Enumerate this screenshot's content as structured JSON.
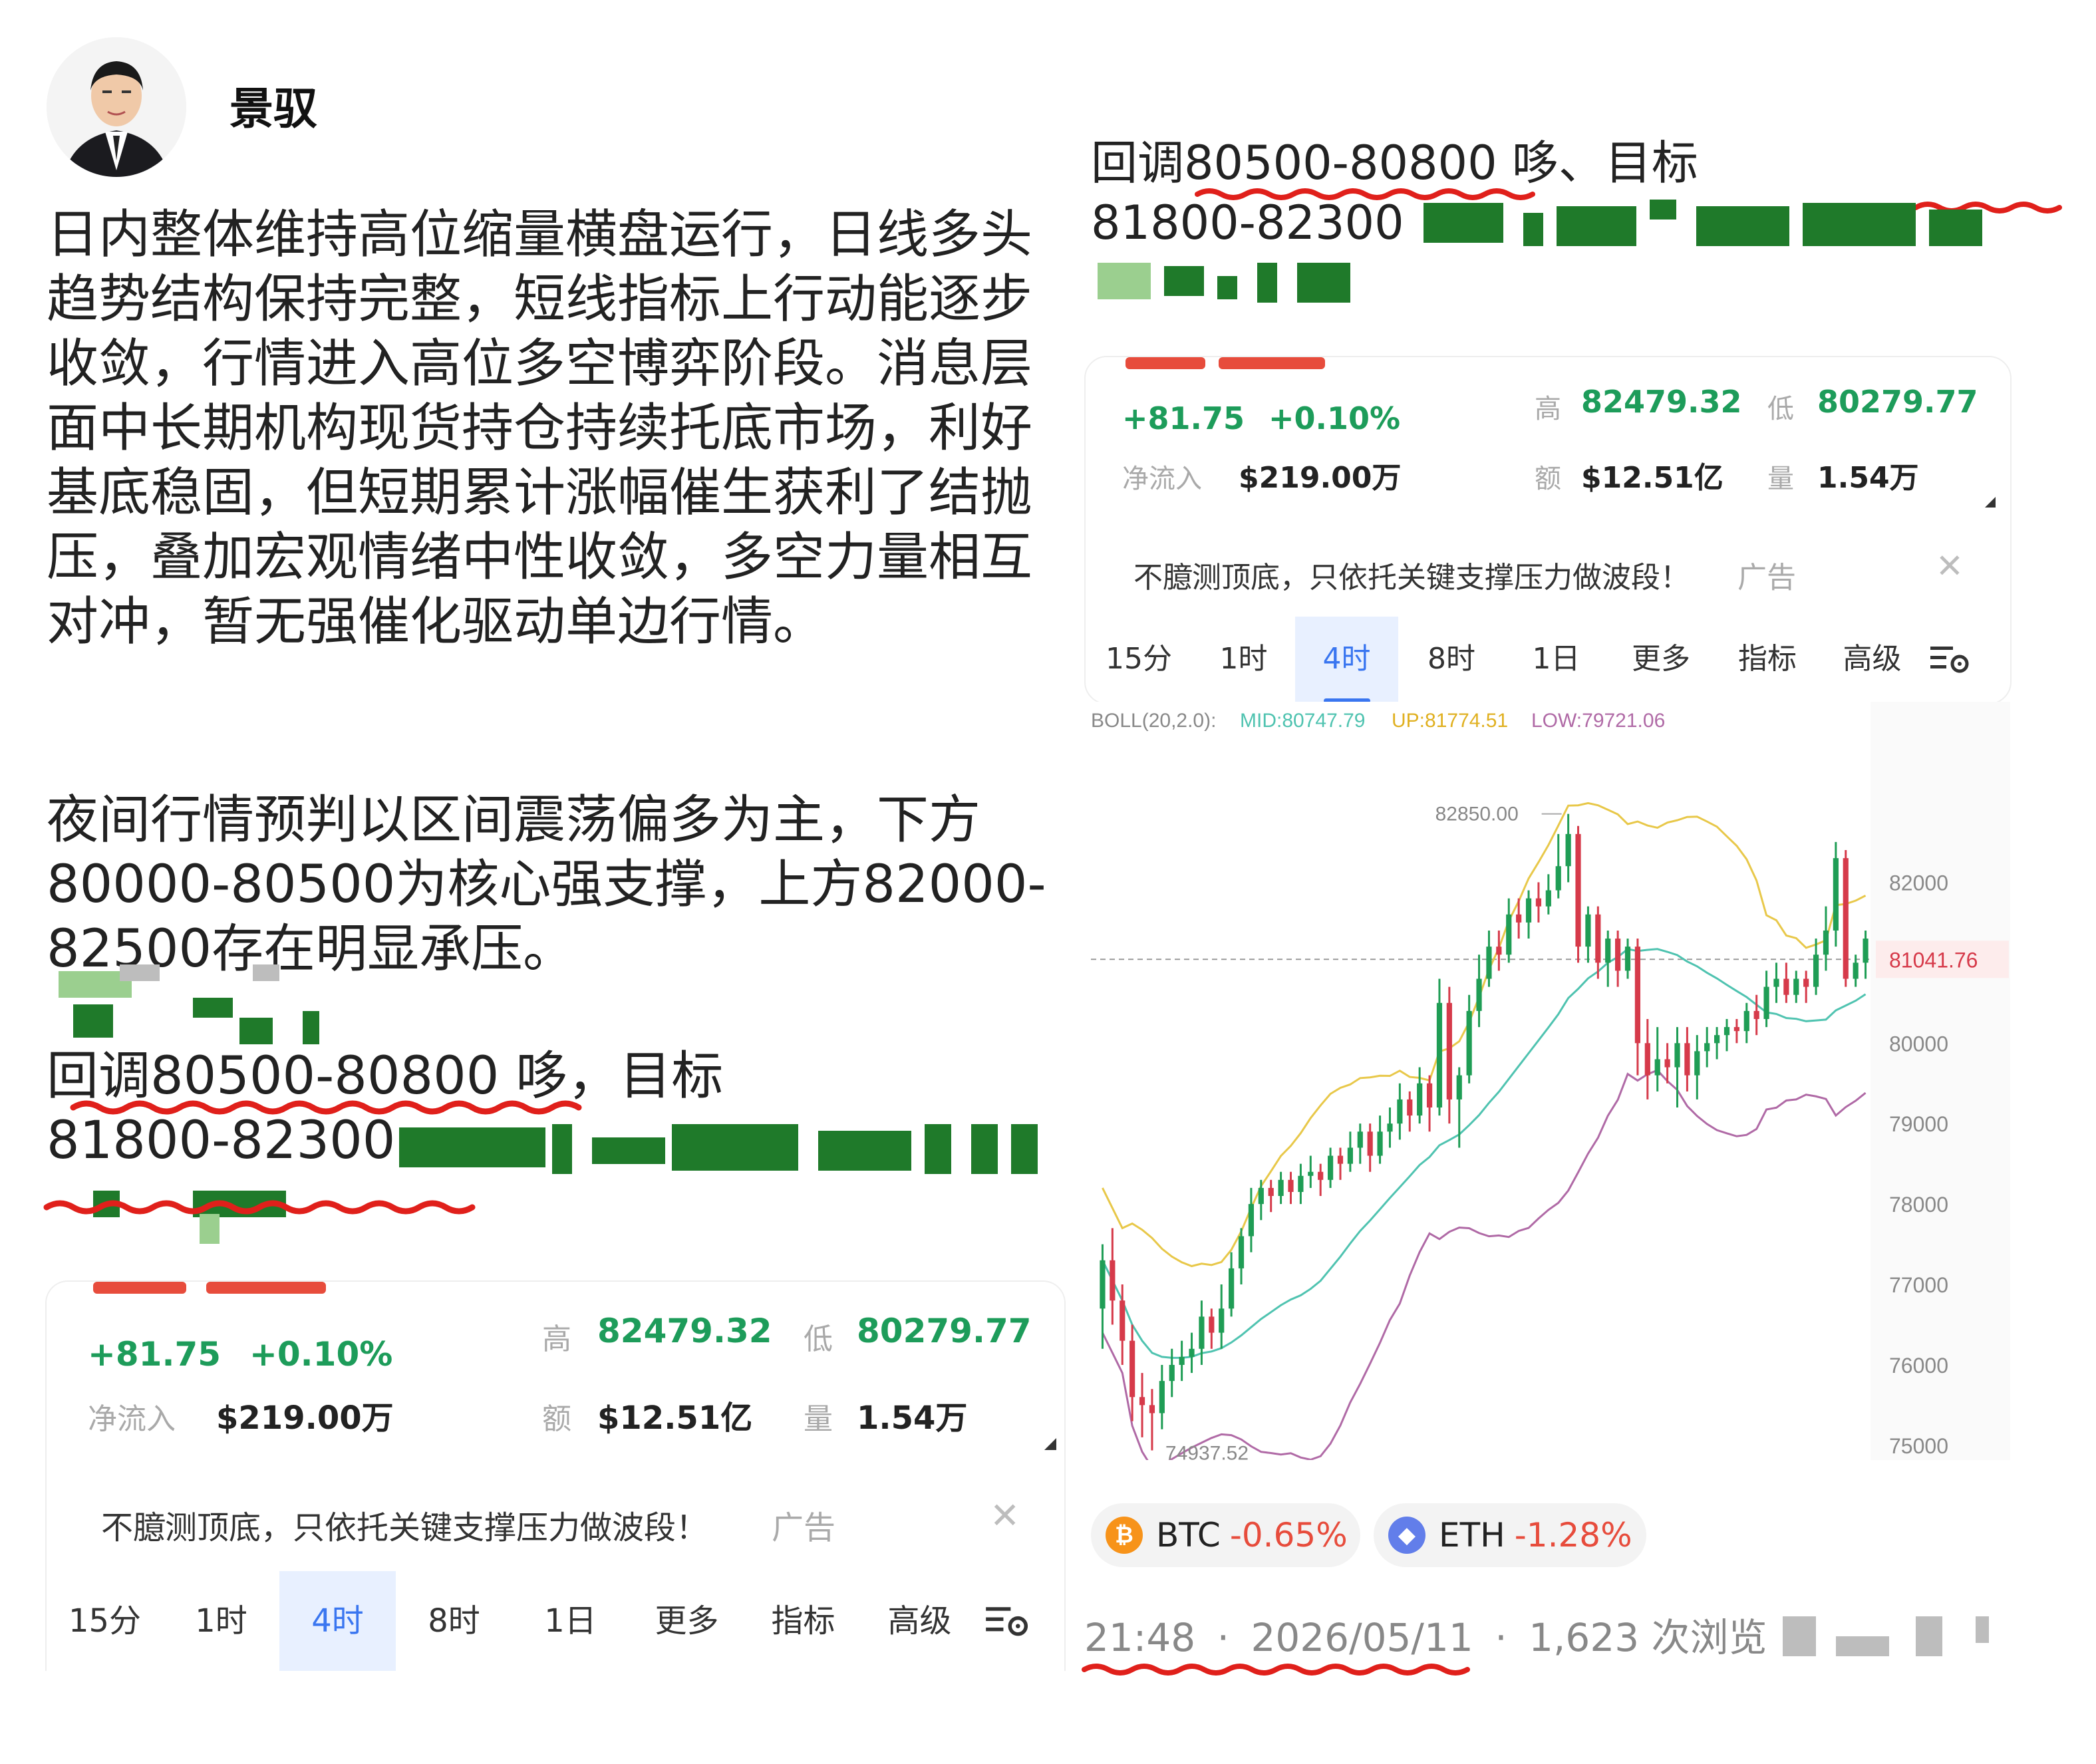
{
  "author": {
    "name": "景驭"
  },
  "post": {
    "para1": "日内整体维持高位缩量横盘运行，日线多头趋势结构保持完整，短线指标上行动能逐步收敛，行情进入高位多空博弈阶段。消息层面中长期机构现货持仓持续托底市场，利好基底稳固，但短期累计涨幅催生获利了结抛压，叠加宏观情绪中性收敛，多空力量相互对冲，暂无强催化驱动单边行情。",
    "para2": "夜间行情预判以区间震荡偏多为主，下方80000-80500为核心强支撑，上方82000-82500存在明显承压。",
    "tip_line1": "回调80500-80800 哆，目标",
    "tip_line2": "81800-82300"
  },
  "right_text": {
    "line1": "回调80500-80800 哆、目标",
    "line2": "81800-82300"
  },
  "ticker": {
    "change": "+81.75",
    "change_pct": "+0.10%",
    "inflow_label": "净流入",
    "inflow_value": "$219.00万",
    "high_label": "高",
    "high_value": "82479.32",
    "low_label": "低",
    "low_value": "80279.77",
    "amount_label": "额",
    "amount_value": "$12.51亿",
    "volume_label": "量",
    "volume_value": "1.54万",
    "ad_text": "不臆测顶底，只依托关键支撑压力做波段！",
    "ad_tag": "广告",
    "close_symbol": "✕",
    "tabs": [
      "15分",
      "1时",
      "4时",
      "8时",
      "1日",
      "更多",
      "指标",
      "高级"
    ],
    "active_tab": "4时"
  },
  "chart_data": {
    "type": "candlestick",
    "indicator": {
      "label": "BOLL(20,2.0):",
      "mid_label": "MID:80747.79",
      "up_label": "UP:81774.51",
      "low_label": "LOW:79721.06"
    },
    "y_ticks": [
      "82000",
      "81041.76",
      "80000",
      "79000",
      "78000",
      "77000",
      "76000",
      "75000"
    ],
    "y_range": [
      74900,
      83500
    ],
    "current_price": 81041.76,
    "max_label": "82850.00",
    "min_label": "74937.52",
    "colors": {
      "up": "#1f9d55",
      "down": "#d63a4a",
      "mid": "#4fc3b0",
      "upper": "#e8c84a",
      "lower": "#b06aa6"
    },
    "candles": [
      [
        76700,
        77300,
        76200,
        77500
      ],
      [
        77300,
        76800,
        76500,
        77700
      ],
      [
        76800,
        76300,
        76000,
        77000
      ],
      [
        76300,
        75600,
        75300,
        76500
      ],
      [
        75600,
        75500,
        75100,
        75900
      ],
      [
        75500,
        75400,
        74937.52,
        75700
      ],
      [
        75400,
        75800,
        75200,
        76000
      ],
      [
        75800,
        76000,
        75600,
        76200
      ],
      [
        76000,
        76100,
        75800,
        76300
      ],
      [
        76100,
        76200,
        75900,
        76400
      ],
      [
        76200,
        76600,
        76000,
        76800
      ],
      [
        76600,
        76400,
        76200,
        76700
      ],
      [
        76400,
        76700,
        76200,
        77000
      ],
      [
        76700,
        77200,
        76600,
        77400
      ],
      [
        77200,
        77600,
        77000,
        77700
      ],
      [
        77600,
        78000,
        77400,
        78200
      ],
      [
        78000,
        78200,
        77800,
        78300
      ],
      [
        78200,
        78100,
        77900,
        78300
      ],
      [
        78100,
        78300,
        78000,
        78400
      ],
      [
        78300,
        78150,
        78000,
        78400
      ],
      [
        78150,
        78350,
        78000,
        78500
      ],
      [
        78350,
        78400,
        78200,
        78600
      ],
      [
        78400,
        78300,
        78100,
        78500
      ],
      [
        78300,
        78600,
        78200,
        78700
      ],
      [
        78600,
        78500,
        78300,
        78700
      ],
      [
        78500,
        78700,
        78400,
        78900
      ],
      [
        78700,
        78900,
        78500,
        79000
      ],
      [
        78900,
        78600,
        78400,
        79000
      ],
      [
        78600,
        78900,
        78500,
        79100
      ],
      [
        78900,
        79000,
        78700,
        79200
      ],
      [
        79000,
        79300,
        78800,
        79500
      ],
      [
        79300,
        79100,
        78900,
        79400
      ],
      [
        79100,
        79500,
        79000,
        79700
      ],
      [
        79500,
        79200,
        78900,
        79600
      ],
      [
        79200,
        80500,
        79100,
        80800
      ],
      [
        80500,
        79300,
        79000,
        80700
      ],
      [
        79300,
        79600,
        78700,
        79700
      ],
      [
        79600,
        80400,
        79500,
        80600
      ],
      [
        80400,
        80800,
        80200,
        81100
      ],
      [
        80800,
        81200,
        80700,
        81400
      ],
      [
        81200,
        81100,
        80900,
        81400
      ],
      [
        81100,
        81600,
        81000,
        81800
      ],
      [
        81600,
        81500,
        81300,
        81800
      ],
      [
        81500,
        81800,
        81300,
        81900
      ],
      [
        81800,
        81700,
        81500,
        82000
      ],
      [
        81700,
        81900,
        81600,
        82100
      ],
      [
        81900,
        82200,
        81800,
        82600
      ],
      [
        82200,
        82600,
        82000,
        82850
      ],
      [
        82600,
        81200,
        81000,
        82700
      ],
      [
        81200,
        81600,
        81000,
        81700
      ],
      [
        81600,
        81000,
        80800,
        81700
      ],
      [
        81000,
        81300,
        80700,
        81400
      ],
      [
        81300,
        80900,
        80700,
        81400
      ],
      [
        80900,
        81200,
        80800,
        81300
      ],
      [
        81200,
        80000,
        79600,
        81300
      ],
      [
        80000,
        79600,
        79300,
        80300
      ],
      [
        79600,
        79800,
        79400,
        80200
      ],
      [
        79800,
        79700,
        79500,
        80000
      ],
      [
        79700,
        80000,
        79200,
        80200
      ],
      [
        80000,
        79600,
        79400,
        80200
      ],
      [
        79600,
        79900,
        79300,
        80100
      ],
      [
        79900,
        80000,
        79700,
        80200
      ],
      [
        80000,
        80100,
        79800,
        80200
      ],
      [
        80100,
        80200,
        79900,
        80300
      ],
      [
        80200,
        80150,
        80000,
        80300
      ],
      [
        80150,
        80400,
        80000,
        80500
      ],
      [
        80400,
        80300,
        80100,
        80600
      ],
      [
        80300,
        80700,
        80200,
        80900
      ],
      [
        80700,
        80800,
        80500,
        81000
      ],
      [
        80800,
        80600,
        80500,
        81000
      ],
      [
        80600,
        80800,
        80500,
        80900
      ],
      [
        80800,
        80700,
        80500,
        80900
      ],
      [
        80700,
        81100,
        80600,
        81300
      ],
      [
        81100,
        81400,
        80900,
        81700
      ],
      [
        81400,
        82300,
        81200,
        82500
      ],
      [
        82300,
        80800,
        80700,
        82400
      ],
      [
        80800,
        81000,
        80700,
        81100
      ],
      [
        81000,
        81300,
        80800,
        81400
      ]
    ]
  },
  "coins": [
    {
      "symbol": "BTC",
      "change": "-0.65%",
      "icon": "bitcoin-icon",
      "color": "#f7931a"
    },
    {
      "symbol": "ETH",
      "change": "-1.28%",
      "icon": "ethereum-icon",
      "color": "#627eea"
    }
  ],
  "meta": {
    "time": "21:48",
    "date": "2026/05/11",
    "views": "1,623 次浏览",
    "sep": "·"
  }
}
